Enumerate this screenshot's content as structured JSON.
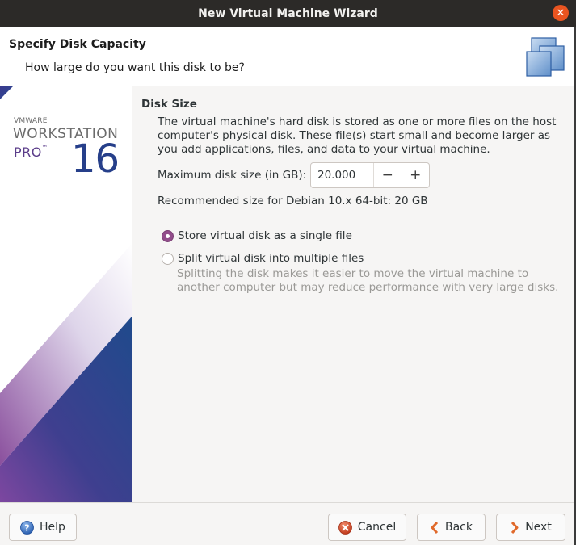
{
  "window": {
    "title": "New Virtual Machine Wizard",
    "close_icon": "close-icon"
  },
  "header": {
    "title": "Specify Disk Capacity",
    "subtitle": "How large do you want this disk to be?",
    "icon": "stacked-disks-icon"
  },
  "brand": {
    "vendor": "VMWARE",
    "product": "WORKSTATION",
    "edition": "PRO",
    "trademark": "™",
    "version": "16"
  },
  "disk_size": {
    "section_title": "Disk Size",
    "description": "The virtual machine's hard disk is stored as one or more files on the host computer's physical disk. These file(s) start small and become larger as you add applications, files, and data to your virtual machine.",
    "max_size_label": "Maximum disk size (in GB):",
    "max_size_value": "20.000",
    "decrement_label": "−",
    "increment_label": "+",
    "recommendation": "Recommended size for Debian 10.x 64-bit: 20 GB"
  },
  "storage_options": {
    "selected": "single",
    "single_label": "Store virtual disk as a single file",
    "split_label": "Split virtual disk into multiple files",
    "split_hint": "Splitting the disk makes it easier to move the virtual machine to another computer but may reduce performance with very large disks."
  },
  "footer": {
    "help_label": "Help",
    "cancel_label": "Cancel",
    "back_label": "Back",
    "next_label": "Next"
  },
  "colors": {
    "accent_radio": "#924d8b",
    "close_button": "#e95420",
    "titlebar": "#2c2a28"
  }
}
